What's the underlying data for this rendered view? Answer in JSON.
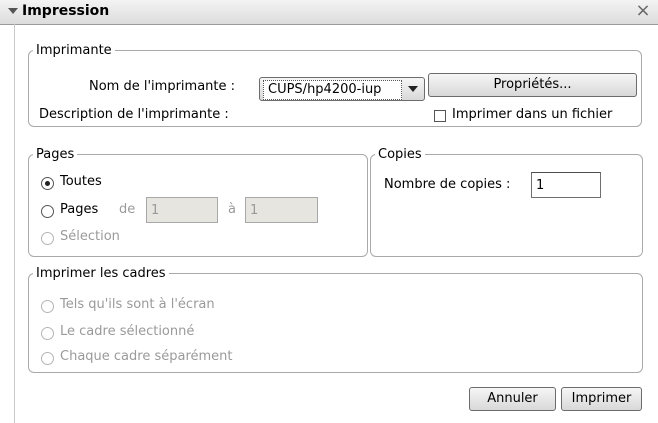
{
  "window": {
    "title": "Impression",
    "close_glyph": "×"
  },
  "printer": {
    "legend": "Imprimante",
    "name_label": "Nom de l'imprimante :",
    "name_value": "CUPS/hp4200-iup",
    "properties_label": "Propriétés...",
    "description_label": "Description de l'imprimante :",
    "print_to_file_label": "Imprimer dans un fichier",
    "print_to_file_checked": false
  },
  "pages": {
    "legend": "Pages",
    "all_label": "Toutes",
    "range_label": "Pages",
    "from_label": "de",
    "from_value": "1",
    "to_label": "à",
    "to_value": "1",
    "selection_label": "Sélection",
    "selected": "all"
  },
  "copies": {
    "legend": "Copies",
    "count_label": "Nombre de copies :",
    "count_value": "1"
  },
  "frames": {
    "legend": "Imprimer les cadres",
    "as_on_screen_label": "Tels qu'ils sont à l'écran",
    "selected_frame_label": "Le cadre sélectionné",
    "each_frame_label": "Chaque cadre séparément"
  },
  "actions": {
    "cancel_label": "Annuler",
    "print_label": "Imprimer"
  },
  "colors": {
    "titlebar": "#dcdcdc",
    "border": "#a9a9a9",
    "disabled_text": "#9a9a9a",
    "disabled_field": "#e6e5e0"
  }
}
